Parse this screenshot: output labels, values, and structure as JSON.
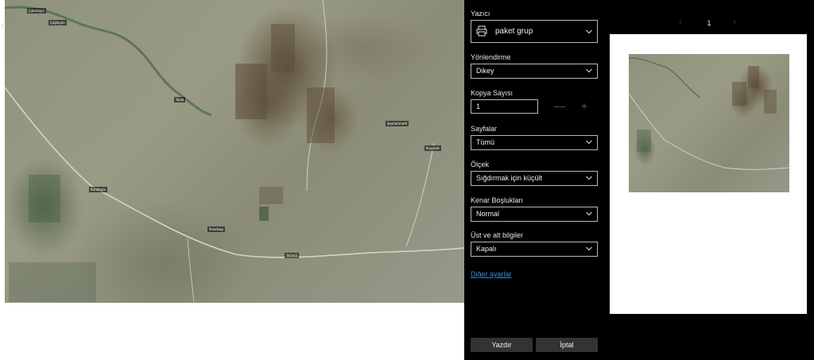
{
  "map": {
    "labels": [
      "Çakırkaya",
      "Çağlayan",
      "Yayla",
      "Şeyhahmetli",
      "Karakaya",
      "Pınarbaşı",
      "Yolüstü",
      "Kuyucak"
    ]
  },
  "print_panel": {
    "printer": {
      "label": "Yazıcı",
      "value": "paket grup",
      "icon": "printer-icon"
    },
    "orientation": {
      "label": "Yönlendirme",
      "value": "Dikey"
    },
    "copies": {
      "label": "Kopya Sayısı",
      "value": "1",
      "decrement": "—",
      "increment": "+"
    },
    "pages": {
      "label": "Sayfalar",
      "value": "Tümü"
    },
    "scale": {
      "label": "Ölçek",
      "value": "Sığdırmak için küçült"
    },
    "margins": {
      "label": "Kenar Boşlukları",
      "value": "Normal"
    },
    "headers_footers": {
      "label": "Üst ve alt bilgiler",
      "value": "Kapalı"
    },
    "more_settings": "Diğer ayarlar",
    "print_button": "Yazdır",
    "cancel_button": "İptal"
  },
  "preview": {
    "page_number": "1",
    "prev_icon": "chevron-left-icon",
    "next_icon": "chevron-right-icon"
  },
  "colors": {
    "panel_bg": "#000000",
    "link": "#3d8bd6",
    "button_bg": "#333333"
  }
}
